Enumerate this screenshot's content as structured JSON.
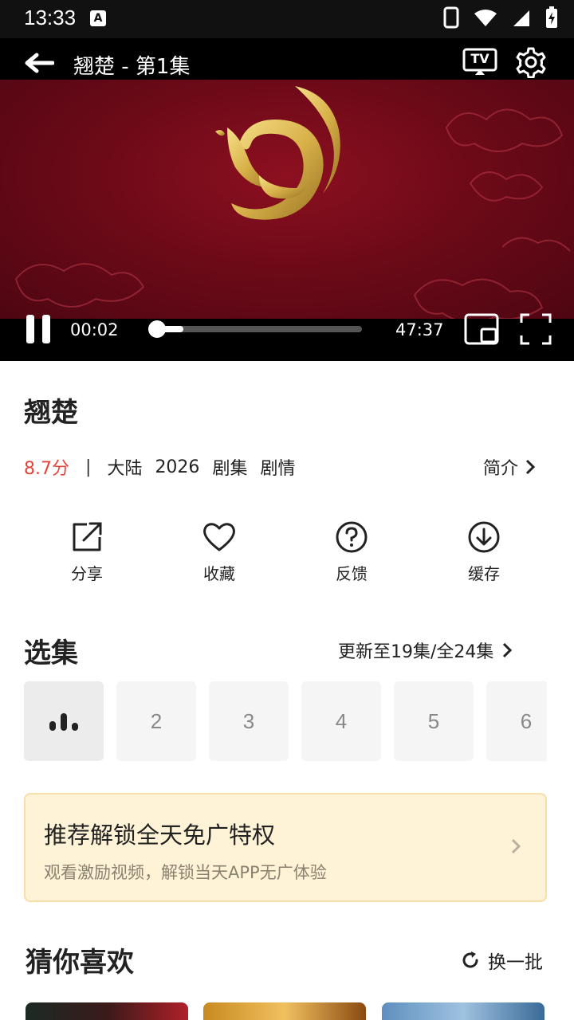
{
  "status_bar": {
    "time": "13:33",
    "a_icon": "A"
  },
  "player": {
    "title": "翘楚 - 第1集",
    "tv_label": "TV",
    "current_time": "00:02",
    "duration": "47:37",
    "progress_fraction": 0.0007
  },
  "show": {
    "title": "翘楚",
    "score": "8.7分",
    "separator": "|",
    "region": "大陆",
    "year": "2026",
    "type": "剧集",
    "genre": "剧情",
    "intro_label": "简介"
  },
  "actions": [
    {
      "label": "分享",
      "icon": "share-icon"
    },
    {
      "label": "收藏",
      "icon": "heart-icon"
    },
    {
      "label": "反馈",
      "icon": "help-icon"
    },
    {
      "label": "缓存",
      "icon": "download-icon"
    }
  ],
  "episodes": {
    "heading": "选集",
    "update_text": "更新至19集/全24集",
    "items": [
      "1",
      "2",
      "3",
      "4",
      "5",
      "6"
    ]
  },
  "promo": {
    "title": "推荐解锁全天免广特权",
    "subtitle": "观看激励视频，解锁当天APP无广体验"
  },
  "recommend": {
    "heading": "猜你喜欢",
    "refresh_label": "换一批"
  },
  "colors": {
    "score": "#e2443a",
    "promo_bg": "#fef3d6",
    "video_bg": "#6e0a18",
    "gold": "#d9b24a"
  }
}
